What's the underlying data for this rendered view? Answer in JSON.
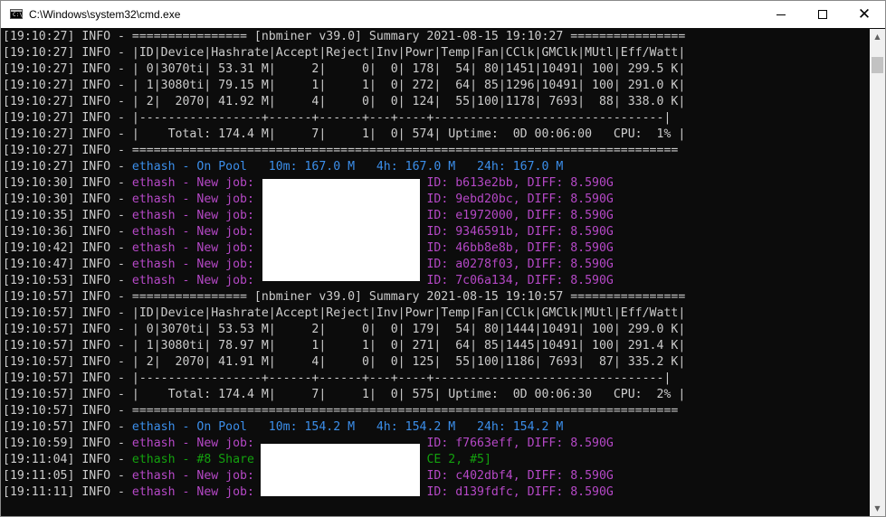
{
  "window": {
    "title": "C:\\Windows\\system32\\cmd.exe",
    "icon": "cmd-icon",
    "icon_text": "C:\\",
    "minimize_icon": "minimize-icon",
    "maximize_icon": "maximize-icon",
    "close_icon": "close-icon",
    "close_glyph": "✕"
  },
  "colors": {
    "background": "#0c0c0c",
    "text": "#cccccc",
    "blue": "#3b8eea",
    "magenta": "#b548c6",
    "green": "#13a10e"
  },
  "console": {
    "lines": [
      [
        {
          "t": "[19:10:27] INFO - ================ [nbminer v39.0] Summary 2021-08-15 19:10:27 ================",
          "c": "default"
        }
      ],
      [
        {
          "t": "[19:10:27] INFO - |ID|Device|Hashrate|Accept|Reject|Inv|Powr|Temp|Fan|CClk|GMClk|MUtl|Eff/Watt|",
          "c": "default"
        }
      ],
      [
        {
          "t": "[19:10:27] INFO - | 0|3070ti| 53.31 M|     2|     0|  0| 178|  54| 80|1451|10491| 100| 299.5 K|",
          "c": "default"
        }
      ],
      [
        {
          "t": "[19:10:27] INFO - | 1|3080ti| 79.15 M|     1|     1|  0| 272|  64| 85|1296|10491| 100| 291.0 K|",
          "c": "default"
        }
      ],
      [
        {
          "t": "[19:10:27] INFO - | 2|  2070| 41.92 M|     4|     0|  0| 124|  55|100|1178| 7693|  88| 338.0 K|",
          "c": "default"
        }
      ],
      [
        {
          "t": "[19:10:27] INFO - |-----------------+------+------+---+----+--------------------------------|",
          "c": "default"
        }
      ],
      [
        {
          "t": "[19:10:27] INFO - |    Total: 174.4 M|     7|     1|  0| 574| Uptime:  0D 00:06:00   CPU:  1% |",
          "c": "default"
        }
      ],
      [
        {
          "t": "[19:10:27] INFO - ============================================================================",
          "c": "default"
        }
      ],
      [
        {
          "t": "[19:10:27] INFO - ",
          "c": "default"
        },
        {
          "t": "ethash - On Pool   10m: 167.0 M   4h: 167.0 M   24h: 167.0 M",
          "c": "blue"
        }
      ],
      [
        {
          "t": "[19:10:30] INFO - ",
          "c": "default"
        },
        {
          "t": "ethash - New job:                        ID: b613e2bb, DIFF: 8.590G",
          "c": "magenta"
        }
      ],
      [
        {
          "t": "[19:10:30] INFO - ",
          "c": "default"
        },
        {
          "t": "ethash - New job:                        ID: 9ebd20bc, DIFF: 8.590G",
          "c": "magenta"
        }
      ],
      [
        {
          "t": "[19:10:35] INFO - ",
          "c": "default"
        },
        {
          "t": "ethash - New job:                        ID: e1972000, DIFF: 8.590G",
          "c": "magenta"
        }
      ],
      [
        {
          "t": "[19:10:36] INFO - ",
          "c": "default"
        },
        {
          "t": "ethash - New job:                        ID: 9346591b, DIFF: 8.590G",
          "c": "magenta"
        }
      ],
      [
        {
          "t": "[19:10:42] INFO - ",
          "c": "default"
        },
        {
          "t": "ethash - New job:                        ID: 46bb8e8b, DIFF: 8.590G",
          "c": "magenta"
        }
      ],
      [
        {
          "t": "[19:10:47] INFO - ",
          "c": "default"
        },
        {
          "t": "ethash - New job:                        ID: a0278f03, DIFF: 8.590G",
          "c": "magenta"
        }
      ],
      [
        {
          "t": "[19:10:53] INFO - ",
          "c": "default"
        },
        {
          "t": "ethash - New job:                        ID: 7c06a134, DIFF: 8.590G",
          "c": "magenta"
        }
      ],
      [
        {
          "t": "[19:10:57] INFO - ================ [nbminer v39.0] Summary 2021-08-15 19:10:57 ================",
          "c": "default"
        }
      ],
      [
        {
          "t": "[19:10:57] INFO - |ID|Device|Hashrate|Accept|Reject|Inv|Powr|Temp|Fan|CClk|GMClk|MUtl|Eff/Watt|",
          "c": "default"
        }
      ],
      [
        {
          "t": "[19:10:57] INFO - | 0|3070ti| 53.53 M|     2|     0|  0| 179|  54| 80|1444|10491| 100| 299.0 K|",
          "c": "default"
        }
      ],
      [
        {
          "t": "[19:10:57] INFO - | 1|3080ti| 78.97 M|     1|     1|  0| 271|  64| 85|1445|10491| 100| 291.4 K|",
          "c": "default"
        }
      ],
      [
        {
          "t": "[19:10:57] INFO - | 2|  2070| 41.91 M|     4|     0|  0| 125|  55|100|1186| 7693|  87| 335.2 K|",
          "c": "default"
        }
      ],
      [
        {
          "t": "[19:10:57] INFO - |-----------------+------+------+---+----+--------------------------------|",
          "c": "default"
        }
      ],
      [
        {
          "t": "[19:10:57] INFO - |    Total: 174.4 M|     7|     1|  0| 575| Uptime:  0D 00:06:30   CPU:  2% |",
          "c": "default"
        }
      ],
      [
        {
          "t": "[19:10:57] INFO - ============================================================================",
          "c": "default"
        }
      ],
      [
        {
          "t": "[19:10:57] INFO - ",
          "c": "default"
        },
        {
          "t": "ethash - On Pool   10m: 154.2 M   4h: 154.2 M   24h: 154.2 M",
          "c": "blue"
        }
      ],
      [
        {
          "t": "[19:10:59] INFO - ",
          "c": "default"
        },
        {
          "t": "ethash - New job:                        ID: f7663eff, DIFF: 8.590G",
          "c": "magenta"
        }
      ],
      [
        {
          "t": "[19:11:04] INFO - ",
          "c": "default"
        },
        {
          "t": "ethash - #8 Share                        CE 2, #5]",
          "c": "green"
        }
      ],
      [
        {
          "t": "[19:11:05] INFO - ",
          "c": "default"
        },
        {
          "t": "ethash - New job:                        ID: c402dbf4, DIFF: 8.590G",
          "c": "magenta"
        }
      ],
      [
        {
          "t": "[19:11:11] INFO - ",
          "c": "default"
        },
        {
          "t": "ethash - New job:                        ID: d139fdfc, DIFF: 8.590G",
          "c": "magenta"
        }
      ]
    ]
  },
  "scrollbar": {
    "up_icon": "scroll-up-arrow-icon",
    "down_icon": "scroll-down-arrow-icon",
    "up_glyph": "▲",
    "down_glyph": "▼"
  }
}
